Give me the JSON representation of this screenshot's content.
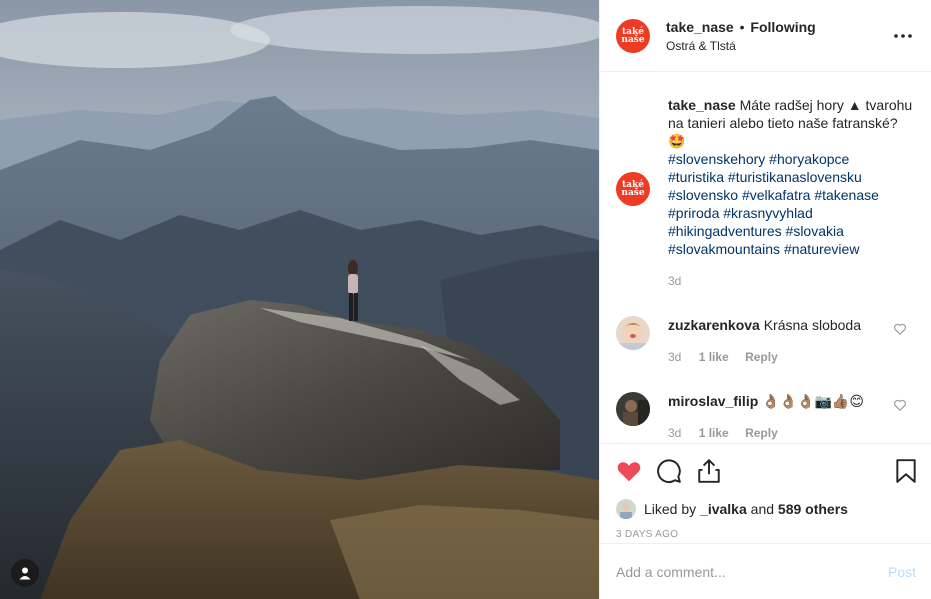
{
  "post": {
    "username": "take_nase",
    "separator": "•",
    "follow_status": "Following",
    "location": "Ostrá & Tlstá",
    "logo_text_top": "také",
    "logo_text_bottom": "naše"
  },
  "caption": {
    "username": "take_nase",
    "text": "Máte radšej hory ▲ tvarohu na tanieri alebo tieto naše fatranské? 🤩",
    "hashtags": [
      "#slovenskehory",
      "#horyakopce",
      "#turistika",
      "#turistikanaslovensku",
      "#slovensko",
      "#velkafatra",
      "#takenase",
      "#priroda",
      "#krasnyvyhlad",
      "#hikingadventures",
      "#slovakia",
      "#slovakmountains",
      "#natureview"
    ],
    "time": "3d"
  },
  "comments": [
    {
      "username": "zuzkarenkova",
      "text": "Krásna sloboda",
      "time": "3d",
      "likes": "1 like",
      "reply": "Reply"
    },
    {
      "username": "miroslav_filip",
      "text": "👌🏽👌🏽👌🏽📷👍🏽😊",
      "time": "3d",
      "likes": "1 like",
      "reply": "Reply"
    }
  ],
  "likes": {
    "prefix": "Liked by",
    "user": "_ivalka",
    "joiner": "and",
    "others": "589 others"
  },
  "date": "3 DAYS AGO",
  "add_comment": {
    "placeholder": "Add a comment...",
    "post_label": "Post"
  },
  "colors": {
    "accent_red": "#ed4956",
    "brand": "#ee3b23",
    "hashtag": "#003569",
    "muted": "#999999",
    "post_disabled": "#b2dffc"
  },
  "icons": [
    "user-tag-icon",
    "more-icon",
    "heart-filled-icon",
    "comment-icon",
    "share-icon",
    "bookmark-icon",
    "heart-outline-icon"
  ]
}
